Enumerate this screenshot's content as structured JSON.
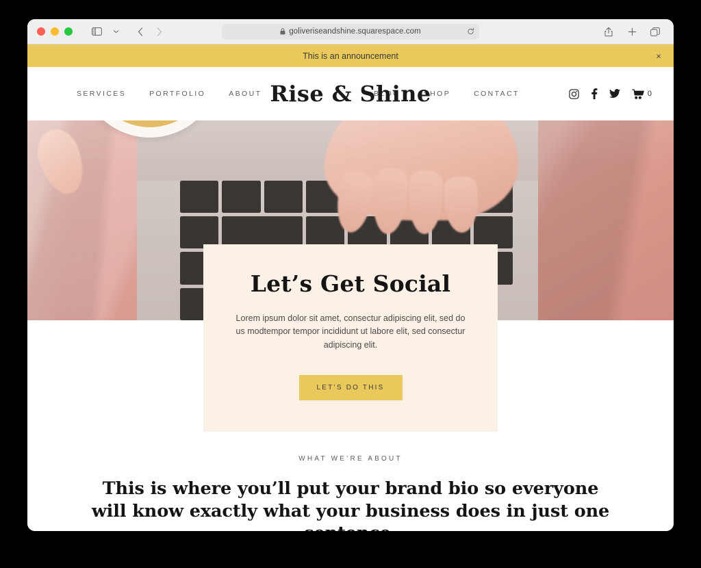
{
  "browser": {
    "url": "goliveriseandshine.squarespace.com",
    "lock_icon": "lock-icon",
    "reload_icon": "reload-icon",
    "sidebar_icon": "sidebar-toggle-icon",
    "chevron_icon": "chevron-down-icon",
    "back_icon": "back-arrow-icon",
    "forward_icon": "forward-arrow-icon",
    "share_icon": "share-icon",
    "newtab_icon": "plus-icon",
    "tabs_icon": "tab-overview-icon",
    "traffic_lights": [
      "close-red",
      "minimize-yellow",
      "zoom-green"
    ]
  },
  "site": {
    "announcement": {
      "text": "This is an announcement",
      "close_label": "×",
      "background": "#e9c95b"
    },
    "header": {
      "logo": "Rise & Shine",
      "nav_left": [
        {
          "label": "SERVICES"
        },
        {
          "label": "PORTFOLIO"
        },
        {
          "label": "ABOUT"
        }
      ],
      "nav_right": [
        {
          "label": "BLOG"
        },
        {
          "label": "SHOP"
        },
        {
          "label": "CONTACT"
        }
      ],
      "social": [
        {
          "name": "instagram-icon"
        },
        {
          "name": "facebook-icon"
        },
        {
          "name": "twitter-icon"
        }
      ],
      "cart": {
        "icon": "shopping-cart-icon",
        "count": "0"
      }
    },
    "hero": {
      "image_description": "Hands typing on a laptop keyboard with a latte cup held above, pink fabric background"
    },
    "promo_card": {
      "title": "Let’s Get Social",
      "body": "Lorem ipsum dolor sit amet, consectur adipiscing elit, sed do us modtempor tempor incididunt ut labore elit, sed consectur adipiscing elit.",
      "cta_label": "LET’S DO THIS",
      "background": "#fcf1e7",
      "cta_background": "#e9c95b"
    },
    "about": {
      "eyebrow": "WHAT WE’RE ABOUT",
      "headline": "This is where you’ll put your brand bio so everyone will know exactly what your business does in just one sentence."
    }
  }
}
